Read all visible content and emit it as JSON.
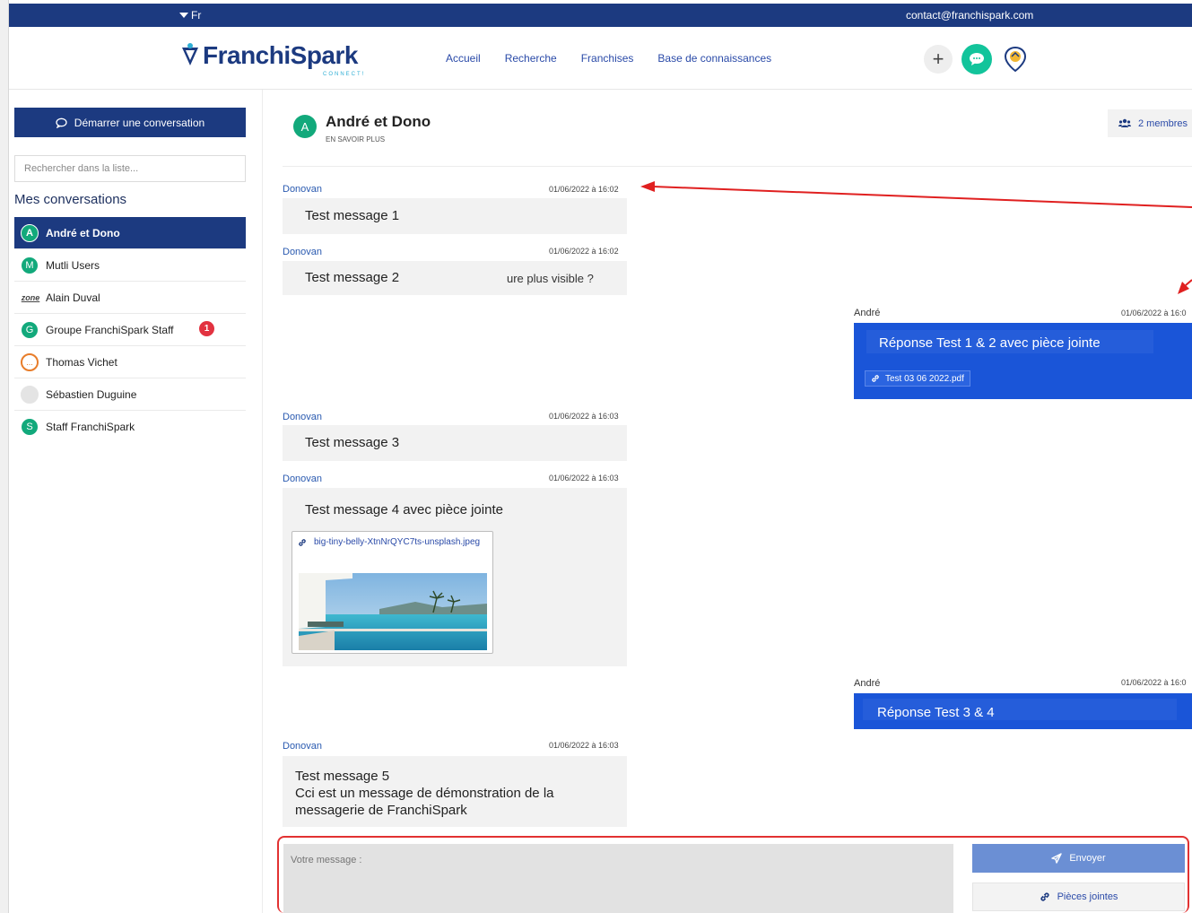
{
  "topbar": {
    "lang": "Fr",
    "email": "contact@franchispark.com"
  },
  "logo": {
    "part1": "Franchi",
    "part2": "Spark",
    "sub": "CONNECT!"
  },
  "nav": [
    "Accueil",
    "Recherche",
    "Franchises",
    "Base de connaissances"
  ],
  "sidebar": {
    "start_label": "Démarrer une conversation",
    "search_placeholder": "Rechercher dans la liste...",
    "title": "Mes conversations",
    "items": [
      {
        "initial": "A",
        "label": "André et Dono",
        "active": true
      },
      {
        "initial": "M",
        "label": "Mutli Users"
      },
      {
        "initial": "zone",
        "label": "Alain Duval"
      },
      {
        "initial": "G",
        "label": "Groupe FranchiSpark Staff",
        "badge": "1"
      },
      {
        "initial": "...",
        "label": "Thomas Vichet"
      },
      {
        "initial": "",
        "label": "Sébastien Duguine"
      },
      {
        "initial": "S",
        "label": "Staff FranchiSpark"
      }
    ]
  },
  "chat": {
    "avatar": "A",
    "name": "André et Dono",
    "more": "EN SAVOIR PLUS",
    "members": "2 membres"
  },
  "messages": [
    {
      "sender": "Donovan",
      "time": "01/06/2022 à 16:02",
      "text": "Test message 1"
    },
    {
      "sender": "Donovan",
      "time": "01/06/2022 à 16:02",
      "text": "Test message 2",
      "extra": "ure plus visible ?"
    },
    {
      "sender": "André",
      "time": "01/06/2022 à 16:0",
      "text": "Réponse Test 1 & 2 avec pièce jointe",
      "attachment": "Test 03 06 2022.pdf"
    },
    {
      "sender": "Donovan",
      "time": "01/06/2022 à 16:03",
      "text": "Test message 3"
    },
    {
      "sender": "Donovan",
      "time": "01/06/2022 à 16:03",
      "text": "Test message 4 avec pièce jointe",
      "attachment": "big-tiny-belly-XtnNrQYC7ts-unsplash.jpeg"
    },
    {
      "sender": "André",
      "time": "01/06/2022 à 16:0",
      "text": "Réponse Test 3 & 4"
    },
    {
      "sender": "Donovan",
      "time": "01/06/2022 à 16:03",
      "lines": [
        "Test message 5",
        "Cci est un message de démonstration de la",
        "messagerie de FranchiSpark"
      ]
    }
  ],
  "compose": {
    "placeholder": "Votre message :",
    "send_label": "Envoyer",
    "attach_label": "Pièces jointes"
  },
  "colors": {
    "brand": "#1c3a80",
    "outgoing": "#1a55d8",
    "accent_green": "#12a97b",
    "annotation_red": "#e02020"
  }
}
